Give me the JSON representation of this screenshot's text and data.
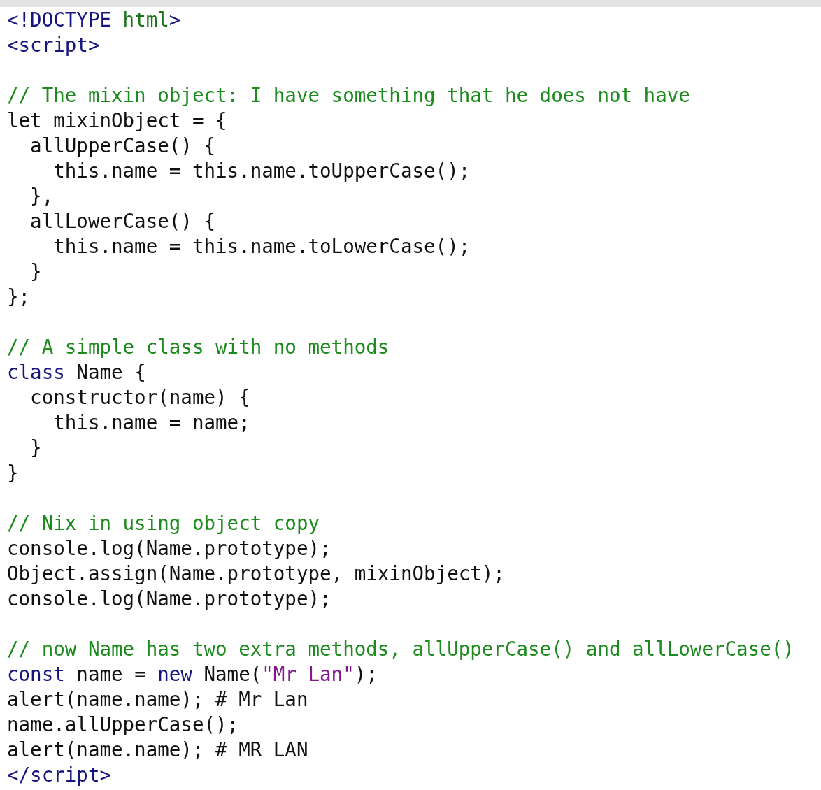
{
  "blocks": [
    {
      "lines": [
        {
          "tokens": [
            {
              "kind": "tag",
              "text": "<!DOCTYPE "
            },
            {
              "kind": "attr",
              "text": "html"
            },
            {
              "kind": "tag",
              "text": ">"
            }
          ]
        },
        {
          "tokens": [
            {
              "kind": "tag",
              "text": "<script>"
            }
          ]
        }
      ]
    },
    {
      "lines": [
        {
          "tokens": [
            {
              "kind": "comment",
              "text": "// The mixin object: I have something that he does not have"
            }
          ]
        },
        {
          "tokens": [
            {
              "kind": "plain",
              "text": "let mixinObject = {"
            }
          ]
        },
        {
          "tokens": [
            {
              "kind": "plain",
              "text": "  allUpperCase() {"
            }
          ]
        },
        {
          "tokens": [
            {
              "kind": "plain",
              "text": "    this.name = this.name.toUpperCase();"
            }
          ]
        },
        {
          "tokens": [
            {
              "kind": "plain",
              "text": "  },"
            }
          ]
        },
        {
          "tokens": [
            {
              "kind": "plain",
              "text": "  allLowerCase() {"
            }
          ]
        },
        {
          "tokens": [
            {
              "kind": "plain",
              "text": "    this.name = this.name.toLowerCase();"
            }
          ]
        },
        {
          "tokens": [
            {
              "kind": "plain",
              "text": "  }"
            }
          ]
        },
        {
          "tokens": [
            {
              "kind": "plain",
              "text": "};"
            }
          ]
        }
      ]
    },
    {
      "lines": [
        {
          "tokens": [
            {
              "kind": "comment",
              "text": "// A simple class with no methods"
            }
          ]
        },
        {
          "tokens": [
            {
              "kind": "keyword",
              "text": "class"
            },
            {
              "kind": "plain",
              "text": " Name {"
            }
          ]
        },
        {
          "tokens": [
            {
              "kind": "plain",
              "text": "  constructor(name) {"
            }
          ]
        },
        {
          "tokens": [
            {
              "kind": "plain",
              "text": "    this.name = name;"
            }
          ]
        },
        {
          "tokens": [
            {
              "kind": "plain",
              "text": "  }"
            }
          ]
        },
        {
          "tokens": [
            {
              "kind": "plain",
              "text": "}"
            }
          ]
        }
      ]
    },
    {
      "lines": [
        {
          "tokens": [
            {
              "kind": "comment",
              "text": "// Nix in using object copy"
            }
          ]
        },
        {
          "tokens": [
            {
              "kind": "plain",
              "text": "console.log(Name.prototype);"
            }
          ]
        },
        {
          "tokens": [
            {
              "kind": "plain",
              "text": "Object.assign(Name.prototype, mixinObject);"
            }
          ]
        },
        {
          "tokens": [
            {
              "kind": "plain",
              "text": "console.log(Name.prototype);"
            }
          ]
        }
      ]
    },
    {
      "lines": [
        {
          "tokens": [
            {
              "kind": "comment",
              "text": "// now Name has two extra methods, allUpperCase() and allLowerCase()"
            }
          ]
        },
        {
          "tokens": [
            {
              "kind": "keyword",
              "text": "const"
            },
            {
              "kind": "plain",
              "text": " name = "
            },
            {
              "kind": "keyword",
              "text": "new"
            },
            {
              "kind": "plain",
              "text": " Name("
            },
            {
              "kind": "string",
              "text": "\"Mr Lan\""
            },
            {
              "kind": "plain",
              "text": ");"
            }
          ]
        },
        {
          "tokens": [
            {
              "kind": "plain",
              "text": "alert(name.name); # Mr Lan"
            }
          ]
        },
        {
          "tokens": [
            {
              "kind": "plain",
              "text": "name.allUpperCase();"
            }
          ]
        },
        {
          "tokens": [
            {
              "kind": "plain",
              "text": "alert(name.name); # MR LAN"
            }
          ]
        },
        {
          "tokens": [
            {
              "kind": "tag",
              "text": "</script>"
            }
          ]
        }
      ]
    }
  ]
}
